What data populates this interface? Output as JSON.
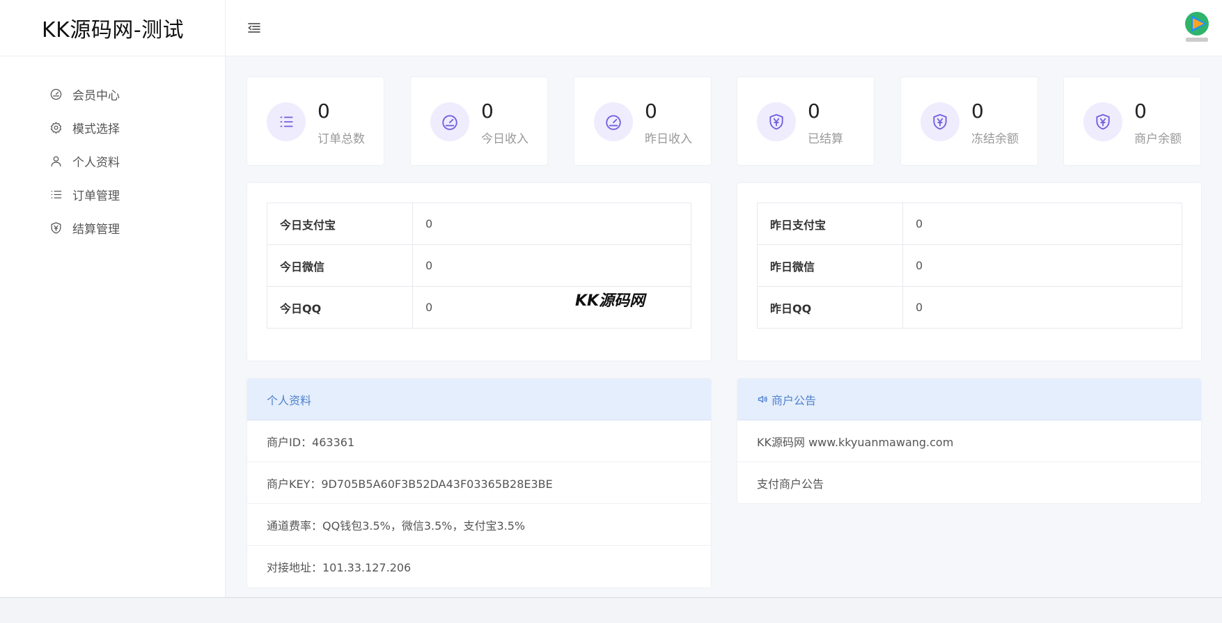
{
  "brand": {
    "title": "KK源码网-测试"
  },
  "sidebar": {
    "items": [
      {
        "label": "会员中心",
        "icon": "dashboard-icon"
      },
      {
        "label": "模式选择",
        "icon": "gear-icon"
      },
      {
        "label": "个人资料",
        "icon": "user-icon"
      },
      {
        "label": "订单管理",
        "icon": "list-icon"
      },
      {
        "label": "结算管理",
        "icon": "shield-yen-icon"
      }
    ]
  },
  "stats": [
    {
      "value": "0",
      "label": "订单总数",
      "icon": "list-icon"
    },
    {
      "value": "0",
      "label": "今日收入",
      "icon": "speedometer-icon"
    },
    {
      "value": "0",
      "label": "昨日收入",
      "icon": "speedometer-icon"
    },
    {
      "value": "0",
      "label": "已结算",
      "icon": "shield-yen-icon"
    },
    {
      "value": "0",
      "label": "冻结余额",
      "icon": "shield-yen-icon"
    },
    {
      "value": "0",
      "label": "商户余额",
      "icon": "shield-yen-icon"
    }
  ],
  "today_table": [
    {
      "key": "今日支付宝",
      "value": "0"
    },
    {
      "key": "今日微信",
      "value": "0"
    },
    {
      "key": "今日QQ",
      "value": "0"
    }
  ],
  "yesterday_table": [
    {
      "key": "昨日支付宝",
      "value": "0"
    },
    {
      "key": "昨日微信",
      "value": "0"
    },
    {
      "key": "昨日QQ",
      "value": "0"
    }
  ],
  "watermark": "KK源码网",
  "profile": {
    "title": "个人资料",
    "rows": [
      "商户ID：463361",
      "商户KEY：9D705B5A60F3B52DA43F03365B28E3BE",
      "通道费率：QQ钱包3.5%，微信3.5%，支付宝3.5%",
      "对接地址：101.33.127.206"
    ]
  },
  "notice": {
    "title": "商户公告",
    "rows": [
      "KK源码网 www.kkyuanmawang.com",
      "支付商户公告"
    ]
  },
  "colors": {
    "accent": "#6f5ee0",
    "info_head_bg": "#e5eefc",
    "info_head_text": "#4f81cf"
  }
}
